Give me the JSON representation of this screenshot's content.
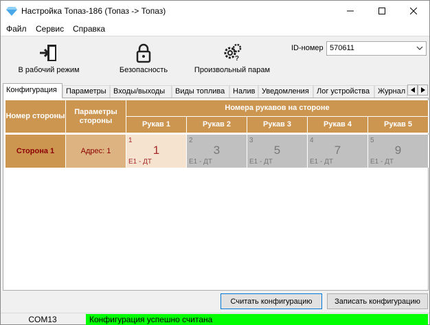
{
  "window": {
    "title": "Настройка Топаз-186 (Топаз -> Топаз)"
  },
  "menu": [
    "Файл",
    "Сервис",
    "Справка"
  ],
  "toolbar": {
    "work_mode": "В рабочий режим",
    "security": "Безопасность",
    "custom_param": "Произвольный парам",
    "id_label": "ID-номер",
    "id_value": "570611"
  },
  "tabs": [
    "Конфигурация",
    "Параметры",
    "Входы/выходы",
    "Виды топлива",
    "Налив",
    "Уведомления",
    "Лог устройства",
    "Журнал"
  ],
  "table": {
    "col_side_number": "Номер стороны",
    "col_side_params": "Параметры стороны",
    "group_header": "Номера рукавов на стороне",
    "hose_headers": [
      "Рукав 1",
      "Рукав 2",
      "Рукав 3",
      "Рукав 4",
      "Рукав 5"
    ],
    "row": {
      "side_name": "Сторона 1",
      "address": "Адрес: 1",
      "hoses": [
        {
          "index": "1",
          "number": "1",
          "fuel": "E1 - ДТ",
          "active": true
        },
        {
          "index": "2",
          "number": "3",
          "fuel": "E1 - ДТ",
          "active": false
        },
        {
          "index": "3",
          "number": "5",
          "fuel": "E1 - ДТ",
          "active": false
        },
        {
          "index": "4",
          "number": "7",
          "fuel": "E1 - ДТ",
          "active": false
        },
        {
          "index": "5",
          "number": "9",
          "fuel": "E1 - ДТ",
          "active": false
        }
      ]
    }
  },
  "buttons": {
    "read": "Считать конфигурацию",
    "write": "Записать конфигурацию"
  },
  "status": {
    "port": "COM13",
    "message": "Конфигурация успешно считана",
    "message_color": "#00ff00"
  },
  "colors": {
    "header": "#cd9650",
    "row_header": "#ddb381",
    "active_hose": "#f5e3cf",
    "inactive_hose": "#c0c0c0"
  }
}
